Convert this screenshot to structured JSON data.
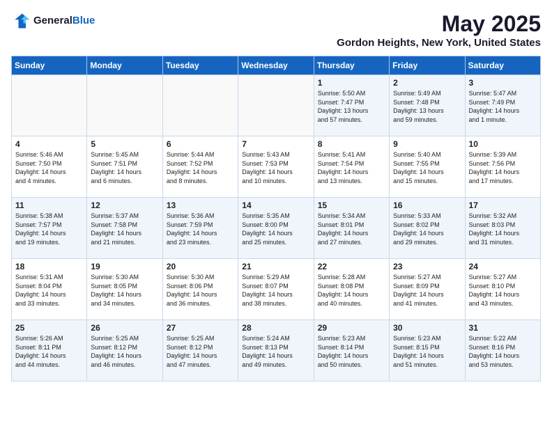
{
  "header": {
    "logo_general": "General",
    "logo_blue": "Blue",
    "month_title": "May 2025",
    "location": "Gordon Heights, New York, United States"
  },
  "days_of_week": [
    "Sunday",
    "Monday",
    "Tuesday",
    "Wednesday",
    "Thursday",
    "Friday",
    "Saturday"
  ],
  "weeks": [
    [
      {
        "day": "",
        "info": ""
      },
      {
        "day": "",
        "info": ""
      },
      {
        "day": "",
        "info": ""
      },
      {
        "day": "",
        "info": ""
      },
      {
        "day": "1",
        "info": "Sunrise: 5:50 AM\nSunset: 7:47 PM\nDaylight: 13 hours\nand 57 minutes."
      },
      {
        "day": "2",
        "info": "Sunrise: 5:49 AM\nSunset: 7:48 PM\nDaylight: 13 hours\nand 59 minutes."
      },
      {
        "day": "3",
        "info": "Sunrise: 5:47 AM\nSunset: 7:49 PM\nDaylight: 14 hours\nand 1 minute."
      }
    ],
    [
      {
        "day": "4",
        "info": "Sunrise: 5:46 AM\nSunset: 7:50 PM\nDaylight: 14 hours\nand 4 minutes."
      },
      {
        "day": "5",
        "info": "Sunrise: 5:45 AM\nSunset: 7:51 PM\nDaylight: 14 hours\nand 6 minutes."
      },
      {
        "day": "6",
        "info": "Sunrise: 5:44 AM\nSunset: 7:52 PM\nDaylight: 14 hours\nand 8 minutes."
      },
      {
        "day": "7",
        "info": "Sunrise: 5:43 AM\nSunset: 7:53 PM\nDaylight: 14 hours\nand 10 minutes."
      },
      {
        "day": "8",
        "info": "Sunrise: 5:41 AM\nSunset: 7:54 PM\nDaylight: 14 hours\nand 13 minutes."
      },
      {
        "day": "9",
        "info": "Sunrise: 5:40 AM\nSunset: 7:55 PM\nDaylight: 14 hours\nand 15 minutes."
      },
      {
        "day": "10",
        "info": "Sunrise: 5:39 AM\nSunset: 7:56 PM\nDaylight: 14 hours\nand 17 minutes."
      }
    ],
    [
      {
        "day": "11",
        "info": "Sunrise: 5:38 AM\nSunset: 7:57 PM\nDaylight: 14 hours\nand 19 minutes."
      },
      {
        "day": "12",
        "info": "Sunrise: 5:37 AM\nSunset: 7:58 PM\nDaylight: 14 hours\nand 21 minutes."
      },
      {
        "day": "13",
        "info": "Sunrise: 5:36 AM\nSunset: 7:59 PM\nDaylight: 14 hours\nand 23 minutes."
      },
      {
        "day": "14",
        "info": "Sunrise: 5:35 AM\nSunset: 8:00 PM\nDaylight: 14 hours\nand 25 minutes."
      },
      {
        "day": "15",
        "info": "Sunrise: 5:34 AM\nSunset: 8:01 PM\nDaylight: 14 hours\nand 27 minutes."
      },
      {
        "day": "16",
        "info": "Sunrise: 5:33 AM\nSunset: 8:02 PM\nDaylight: 14 hours\nand 29 minutes."
      },
      {
        "day": "17",
        "info": "Sunrise: 5:32 AM\nSunset: 8:03 PM\nDaylight: 14 hours\nand 31 minutes."
      }
    ],
    [
      {
        "day": "18",
        "info": "Sunrise: 5:31 AM\nSunset: 8:04 PM\nDaylight: 14 hours\nand 33 minutes."
      },
      {
        "day": "19",
        "info": "Sunrise: 5:30 AM\nSunset: 8:05 PM\nDaylight: 14 hours\nand 34 minutes."
      },
      {
        "day": "20",
        "info": "Sunrise: 5:30 AM\nSunset: 8:06 PM\nDaylight: 14 hours\nand 36 minutes."
      },
      {
        "day": "21",
        "info": "Sunrise: 5:29 AM\nSunset: 8:07 PM\nDaylight: 14 hours\nand 38 minutes."
      },
      {
        "day": "22",
        "info": "Sunrise: 5:28 AM\nSunset: 8:08 PM\nDaylight: 14 hours\nand 40 minutes."
      },
      {
        "day": "23",
        "info": "Sunrise: 5:27 AM\nSunset: 8:09 PM\nDaylight: 14 hours\nand 41 minutes."
      },
      {
        "day": "24",
        "info": "Sunrise: 5:27 AM\nSunset: 8:10 PM\nDaylight: 14 hours\nand 43 minutes."
      }
    ],
    [
      {
        "day": "25",
        "info": "Sunrise: 5:26 AM\nSunset: 8:11 PM\nDaylight: 14 hours\nand 44 minutes."
      },
      {
        "day": "26",
        "info": "Sunrise: 5:25 AM\nSunset: 8:12 PM\nDaylight: 14 hours\nand 46 minutes."
      },
      {
        "day": "27",
        "info": "Sunrise: 5:25 AM\nSunset: 8:12 PM\nDaylight: 14 hours\nand 47 minutes."
      },
      {
        "day": "28",
        "info": "Sunrise: 5:24 AM\nSunset: 8:13 PM\nDaylight: 14 hours\nand 49 minutes."
      },
      {
        "day": "29",
        "info": "Sunrise: 5:23 AM\nSunset: 8:14 PM\nDaylight: 14 hours\nand 50 minutes."
      },
      {
        "day": "30",
        "info": "Sunrise: 5:23 AM\nSunset: 8:15 PM\nDaylight: 14 hours\nand 51 minutes."
      },
      {
        "day": "31",
        "info": "Sunrise: 5:22 AM\nSunset: 8:16 PM\nDaylight: 14 hours\nand 53 minutes."
      }
    ]
  ]
}
